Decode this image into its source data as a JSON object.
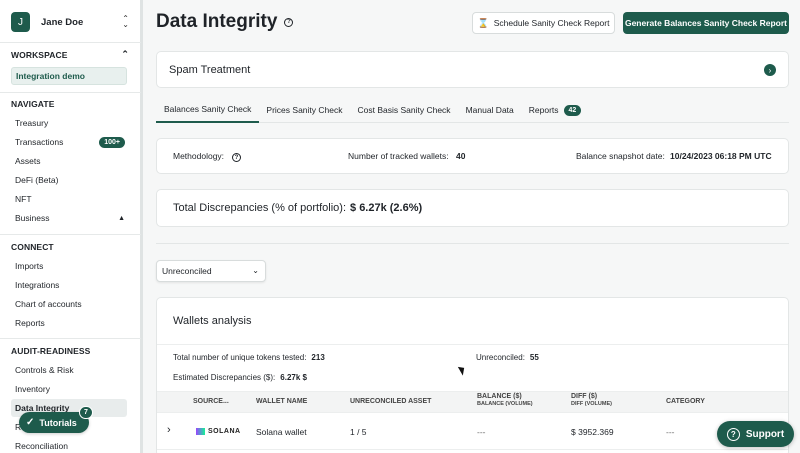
{
  "user": {
    "initial": "J",
    "name": "Jane Doe"
  },
  "sidebar": {
    "workspace": {
      "header": "WORKSPACE",
      "active": "Integration demo"
    },
    "navigate": {
      "header": "NAVIGATE",
      "items": [
        {
          "label": "Treasury"
        },
        {
          "label": "Transactions",
          "badge": "100+"
        },
        {
          "label": "Assets"
        },
        {
          "label": "DeFi (Beta)"
        },
        {
          "label": "NFT"
        },
        {
          "label": "Business"
        }
      ]
    },
    "connect": {
      "header": "CONNECT",
      "items": [
        {
          "label": "Imports"
        },
        {
          "label": "Integrations"
        },
        {
          "label": "Chart of accounts"
        },
        {
          "label": "Reports"
        }
      ]
    },
    "audit": {
      "header": "AUDIT-READINESS",
      "items": [
        {
          "label": "Controls & Risk"
        },
        {
          "label": "Inventory"
        },
        {
          "label": "Data Integrity"
        },
        {
          "label": "R"
        },
        {
          "label": "Reconciliation"
        }
      ]
    },
    "tutorials": {
      "label": "Tutorials",
      "badge": "7"
    }
  },
  "page": {
    "title": "Data Integrity",
    "schedule_btn": "Schedule Sanity Check Report",
    "generate_btn": "Generate Balances Sanity Check Report",
    "spam": "Spam Treatment",
    "tabs": [
      {
        "label": "Balances Sanity Check"
      },
      {
        "label": "Prices Sanity Check"
      },
      {
        "label": "Cost Basis Sanity Check"
      },
      {
        "label": "Manual Data"
      },
      {
        "label": "Reports",
        "badge": "42"
      }
    ],
    "meta": {
      "methodology": "Methodology:",
      "wallets_label": "Number of tracked wallets:",
      "wallets_value": "40",
      "snapshot_label": "Balance snapshot date:",
      "snapshot_value": "10/24/2023 06:18 PM UTC"
    },
    "discrepancy": {
      "label": "Total Discrepancies (% of portfolio):",
      "value": "$ 6.27k (2.6%)"
    },
    "filter": {
      "value": "Unreconciled"
    },
    "wallets": {
      "title": "Wallets analysis",
      "tokens_label": "Total number of unique tokens tested:",
      "tokens_value": "213",
      "unreconciled_label": "Unreconciled:",
      "unreconciled_value": "55",
      "est_label": "Estimated Discrepancies ($):",
      "est_value": "6.27k $",
      "columns": {
        "source": "SOURCE...",
        "wallet_name": "WALLET NAME",
        "asset": "UNRECONCILED ASSET",
        "balance": "BALANCE ($)",
        "balance_sub": "BALANCE (VOLUME)",
        "diff": "DIFF ($)",
        "diff_sub": "DIFF (VOLUME)",
        "category": "CATEGORY"
      },
      "rows": [
        {
          "source": "SOLANA",
          "wallet": "Solana wallet",
          "asset": "1 / 5",
          "balance": "---",
          "diff": "$ 3952.369",
          "category": "---"
        }
      ]
    }
  },
  "support": {
    "label": "Support"
  },
  "colors": {
    "brand": "#1e5b4c"
  }
}
